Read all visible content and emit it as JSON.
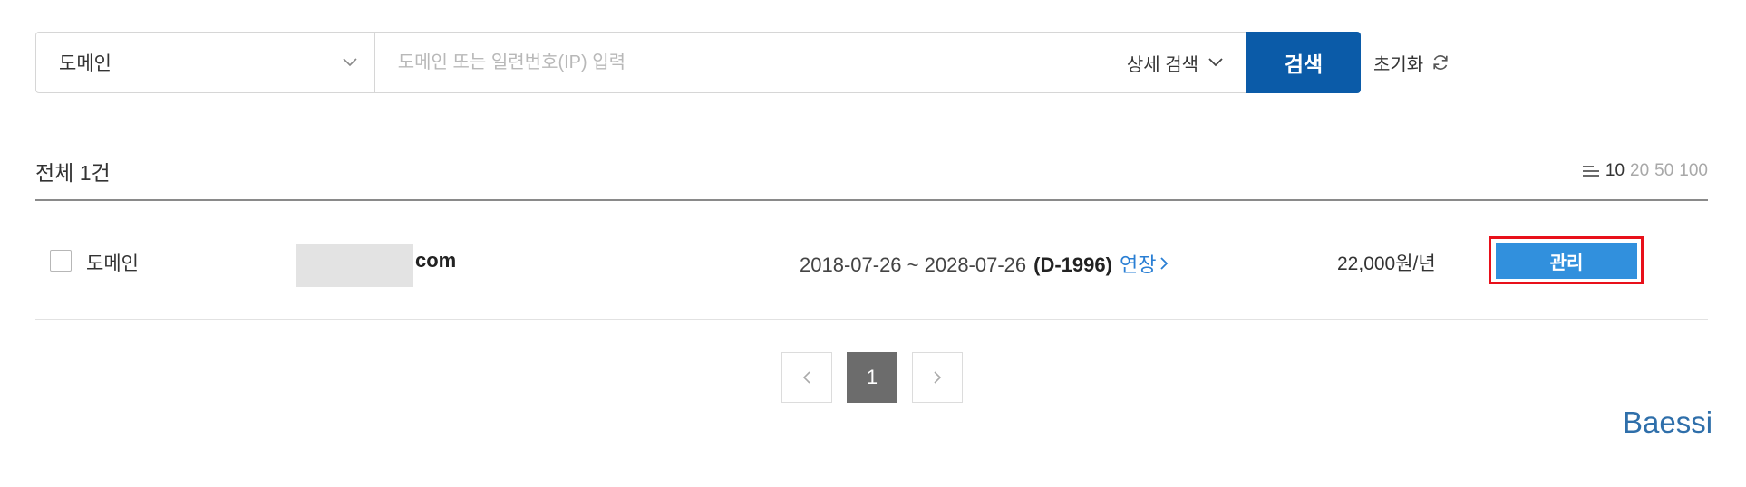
{
  "search": {
    "category_selected": "도메인",
    "query_value": "",
    "query_placeholder": "도메인 또는 일련번호(IP) 입력",
    "advanced_label": "상세 검색",
    "submit_label": "검색",
    "reset_label": "초기화"
  },
  "list": {
    "total_label": "전체 1건",
    "page_size_options": [
      "10",
      "20",
      "50",
      "100"
    ],
    "page_size_selected": "10"
  },
  "row": {
    "type_label": "도메인",
    "domain_suffix": "com",
    "period": "2018-07-26 ~ 2028-07-26",
    "dday": "(D-1996)",
    "extend_label": "연장",
    "price": "22,000원/년",
    "manage_label": "관리"
  },
  "pagination": {
    "current": "1"
  },
  "watermark": "Baessi",
  "colors": {
    "search_button": "#0b5ba8",
    "manage_button": "#3190dd",
    "highlight_outline": "#e8101a",
    "link": "#2a7fd4",
    "current_page": "#6c6c6c"
  },
  "icons": {
    "dropdown": "chevron-down-icon",
    "reset": "refresh-icon",
    "page_size": "list-lines-icon",
    "extend": "chevron-right-icon",
    "prev": "chevron-left-icon",
    "next": "chevron-right-icon"
  }
}
